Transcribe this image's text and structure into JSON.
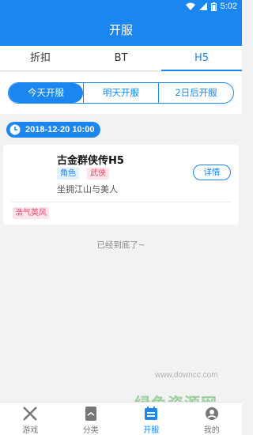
{
  "status": {
    "time": "5:02"
  },
  "appbar": {
    "title": "开服"
  },
  "tabs": [
    {
      "label": "折扣",
      "active": false
    },
    {
      "label": "BT",
      "active": false
    },
    {
      "label": "H5",
      "active": true
    }
  ],
  "segments": [
    {
      "label": "今天开服",
      "active": true
    },
    {
      "label": "明天开服",
      "active": false
    },
    {
      "label": "2日后开服",
      "active": false
    }
  ],
  "date_header": "2018-12-20 10:00",
  "game": {
    "title": "古金群侠传H5",
    "tags": [
      "角色",
      "武侠"
    ],
    "description": "坐拥江山与美人",
    "detail_label": "详情",
    "server_name": "浩气英风"
  },
  "end_text": "已经到底了~",
  "watermark": {
    "text": "绿色资源网",
    "url": "www.downcc.com"
  },
  "bottom_nav": [
    {
      "label": "游戏",
      "icon": "swords-icon",
      "active": false
    },
    {
      "label": "分类",
      "icon": "book-icon",
      "active": false
    },
    {
      "label": "开服",
      "icon": "calendar-icon",
      "active": true
    },
    {
      "label": "我的",
      "icon": "profile-icon",
      "active": false
    }
  ],
  "colors": {
    "primary": "#1c86f0",
    "tag_pink": "#e8476a",
    "background": "#f2f2f2"
  }
}
